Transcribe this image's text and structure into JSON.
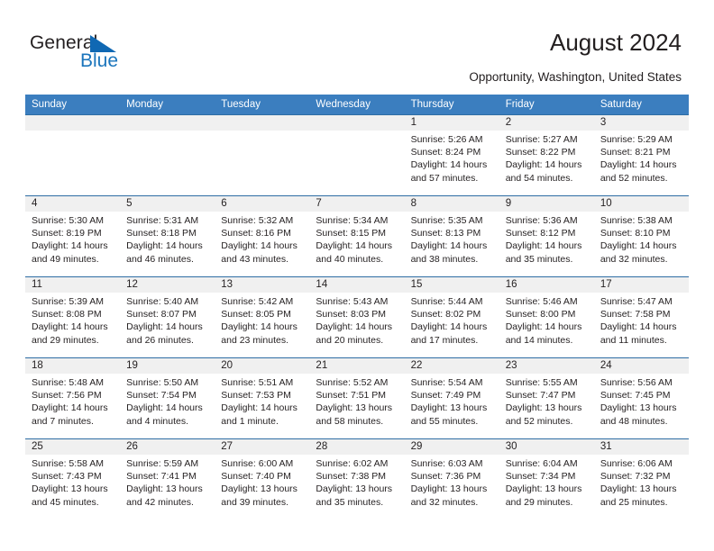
{
  "brand": {
    "name_top": "General",
    "name_bottom": "Blue",
    "accent_color": "#1b75bc"
  },
  "header": {
    "title": "August 2024",
    "subtitle": "Opportunity, Washington, United States"
  },
  "calendar": {
    "header_bg": "#3b7ebf",
    "daynum_bg": "#f0f0f0",
    "row_border_color": "#2e6da4",
    "weekdays": [
      "Sunday",
      "Monday",
      "Tuesday",
      "Wednesday",
      "Thursday",
      "Friday",
      "Saturday"
    ],
    "weeks": [
      [
        {
          "day": "",
          "empty": true
        },
        {
          "day": "",
          "empty": true
        },
        {
          "day": "",
          "empty": true
        },
        {
          "day": "",
          "empty": true
        },
        {
          "day": "1",
          "sunrise": "Sunrise: 5:26 AM",
          "sunset": "Sunset: 8:24 PM",
          "daylight_line1": "Daylight: 14 hours",
          "daylight_line2": "and 57 minutes."
        },
        {
          "day": "2",
          "sunrise": "Sunrise: 5:27 AM",
          "sunset": "Sunset: 8:22 PM",
          "daylight_line1": "Daylight: 14 hours",
          "daylight_line2": "and 54 minutes."
        },
        {
          "day": "3",
          "sunrise": "Sunrise: 5:29 AM",
          "sunset": "Sunset: 8:21 PM",
          "daylight_line1": "Daylight: 14 hours",
          "daylight_line2": "and 52 minutes."
        }
      ],
      [
        {
          "day": "4",
          "sunrise": "Sunrise: 5:30 AM",
          "sunset": "Sunset: 8:19 PM",
          "daylight_line1": "Daylight: 14 hours",
          "daylight_line2": "and 49 minutes."
        },
        {
          "day": "5",
          "sunrise": "Sunrise: 5:31 AM",
          "sunset": "Sunset: 8:18 PM",
          "daylight_line1": "Daylight: 14 hours",
          "daylight_line2": "and 46 minutes."
        },
        {
          "day": "6",
          "sunrise": "Sunrise: 5:32 AM",
          "sunset": "Sunset: 8:16 PM",
          "daylight_line1": "Daylight: 14 hours",
          "daylight_line2": "and 43 minutes."
        },
        {
          "day": "7",
          "sunrise": "Sunrise: 5:34 AM",
          "sunset": "Sunset: 8:15 PM",
          "daylight_line1": "Daylight: 14 hours",
          "daylight_line2": "and 40 minutes."
        },
        {
          "day": "8",
          "sunrise": "Sunrise: 5:35 AM",
          "sunset": "Sunset: 8:13 PM",
          "daylight_line1": "Daylight: 14 hours",
          "daylight_line2": "and 38 minutes."
        },
        {
          "day": "9",
          "sunrise": "Sunrise: 5:36 AM",
          "sunset": "Sunset: 8:12 PM",
          "daylight_line1": "Daylight: 14 hours",
          "daylight_line2": "and 35 minutes."
        },
        {
          "day": "10",
          "sunrise": "Sunrise: 5:38 AM",
          "sunset": "Sunset: 8:10 PM",
          "daylight_line1": "Daylight: 14 hours",
          "daylight_line2": "and 32 minutes."
        }
      ],
      [
        {
          "day": "11",
          "sunrise": "Sunrise: 5:39 AM",
          "sunset": "Sunset: 8:08 PM",
          "daylight_line1": "Daylight: 14 hours",
          "daylight_line2": "and 29 minutes."
        },
        {
          "day": "12",
          "sunrise": "Sunrise: 5:40 AM",
          "sunset": "Sunset: 8:07 PM",
          "daylight_line1": "Daylight: 14 hours",
          "daylight_line2": "and 26 minutes."
        },
        {
          "day": "13",
          "sunrise": "Sunrise: 5:42 AM",
          "sunset": "Sunset: 8:05 PM",
          "daylight_line1": "Daylight: 14 hours",
          "daylight_line2": "and 23 minutes."
        },
        {
          "day": "14",
          "sunrise": "Sunrise: 5:43 AM",
          "sunset": "Sunset: 8:03 PM",
          "daylight_line1": "Daylight: 14 hours",
          "daylight_line2": "and 20 minutes."
        },
        {
          "day": "15",
          "sunrise": "Sunrise: 5:44 AM",
          "sunset": "Sunset: 8:02 PM",
          "daylight_line1": "Daylight: 14 hours",
          "daylight_line2": "and 17 minutes."
        },
        {
          "day": "16",
          "sunrise": "Sunrise: 5:46 AM",
          "sunset": "Sunset: 8:00 PM",
          "daylight_line1": "Daylight: 14 hours",
          "daylight_line2": "and 14 minutes."
        },
        {
          "day": "17",
          "sunrise": "Sunrise: 5:47 AM",
          "sunset": "Sunset: 7:58 PM",
          "daylight_line1": "Daylight: 14 hours",
          "daylight_line2": "and 11 minutes."
        }
      ],
      [
        {
          "day": "18",
          "sunrise": "Sunrise: 5:48 AM",
          "sunset": "Sunset: 7:56 PM",
          "daylight_line1": "Daylight: 14 hours",
          "daylight_line2": "and 7 minutes."
        },
        {
          "day": "19",
          "sunrise": "Sunrise: 5:50 AM",
          "sunset": "Sunset: 7:54 PM",
          "daylight_line1": "Daylight: 14 hours",
          "daylight_line2": "and 4 minutes."
        },
        {
          "day": "20",
          "sunrise": "Sunrise: 5:51 AM",
          "sunset": "Sunset: 7:53 PM",
          "daylight_line1": "Daylight: 14 hours",
          "daylight_line2": "and 1 minute."
        },
        {
          "day": "21",
          "sunrise": "Sunrise: 5:52 AM",
          "sunset": "Sunset: 7:51 PM",
          "daylight_line1": "Daylight: 13 hours",
          "daylight_line2": "and 58 minutes."
        },
        {
          "day": "22",
          "sunrise": "Sunrise: 5:54 AM",
          "sunset": "Sunset: 7:49 PM",
          "daylight_line1": "Daylight: 13 hours",
          "daylight_line2": "and 55 minutes."
        },
        {
          "day": "23",
          "sunrise": "Sunrise: 5:55 AM",
          "sunset": "Sunset: 7:47 PM",
          "daylight_line1": "Daylight: 13 hours",
          "daylight_line2": "and 52 minutes."
        },
        {
          "day": "24",
          "sunrise": "Sunrise: 5:56 AM",
          "sunset": "Sunset: 7:45 PM",
          "daylight_line1": "Daylight: 13 hours",
          "daylight_line2": "and 48 minutes."
        }
      ],
      [
        {
          "day": "25",
          "sunrise": "Sunrise: 5:58 AM",
          "sunset": "Sunset: 7:43 PM",
          "daylight_line1": "Daylight: 13 hours",
          "daylight_line2": "and 45 minutes."
        },
        {
          "day": "26",
          "sunrise": "Sunrise: 5:59 AM",
          "sunset": "Sunset: 7:41 PM",
          "daylight_line1": "Daylight: 13 hours",
          "daylight_line2": "and 42 minutes."
        },
        {
          "day": "27",
          "sunrise": "Sunrise: 6:00 AM",
          "sunset": "Sunset: 7:40 PM",
          "daylight_line1": "Daylight: 13 hours",
          "daylight_line2": "and 39 minutes."
        },
        {
          "day": "28",
          "sunrise": "Sunrise: 6:02 AM",
          "sunset": "Sunset: 7:38 PM",
          "daylight_line1": "Daylight: 13 hours",
          "daylight_line2": "and 35 minutes."
        },
        {
          "day": "29",
          "sunrise": "Sunrise: 6:03 AM",
          "sunset": "Sunset: 7:36 PM",
          "daylight_line1": "Daylight: 13 hours",
          "daylight_line2": "and 32 minutes."
        },
        {
          "day": "30",
          "sunrise": "Sunrise: 6:04 AM",
          "sunset": "Sunset: 7:34 PM",
          "daylight_line1": "Daylight: 13 hours",
          "daylight_line2": "and 29 minutes."
        },
        {
          "day": "31",
          "sunrise": "Sunrise: 6:06 AM",
          "sunset": "Sunset: 7:32 PM",
          "daylight_line1": "Daylight: 13 hours",
          "daylight_line2": "and 25 minutes."
        }
      ]
    ]
  }
}
